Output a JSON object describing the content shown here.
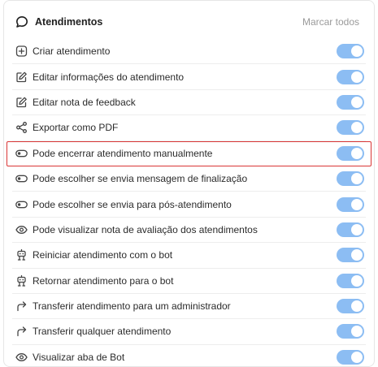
{
  "header": {
    "title": "Atendimentos",
    "mark_all": "Marcar todos",
    "icon": "chat-bubble-icon"
  },
  "colors": {
    "toggle_on": "#8cbdf3",
    "highlight_border": "#d93636"
  },
  "permissions": [
    {
      "label": "Criar atendimento",
      "icon": "plus-square-icon",
      "enabled": true
    },
    {
      "label": "Editar informações do atendimento",
      "icon": "edit-icon",
      "enabled": true
    },
    {
      "label": "Editar nota de feedback",
      "icon": "edit-icon",
      "enabled": true
    },
    {
      "label": "Exportar como PDF",
      "icon": "share-icon",
      "enabled": true
    },
    {
      "label": "Pode encerrar atendimento manualmente",
      "icon": "toggle-icon",
      "enabled": true,
      "highlighted": true
    },
    {
      "label": "Pode escolher se envia mensagem de finalização",
      "icon": "toggle-icon",
      "enabled": true
    },
    {
      "label": "Pode escolher se envia para pós-atendimento",
      "icon": "toggle-icon",
      "enabled": true
    },
    {
      "label": "Pode visualizar nota de avaliação dos atendimentos",
      "icon": "eye-icon",
      "enabled": true
    },
    {
      "label": "Reiniciar atendimento com o bot",
      "icon": "robot-icon",
      "enabled": true
    },
    {
      "label": "Retornar atendimento para o bot",
      "icon": "robot-icon",
      "enabled": true
    },
    {
      "label": "Transferir atendimento para um administrador",
      "icon": "forward-arrow-icon",
      "enabled": true
    },
    {
      "label": "Transferir qualquer atendimento",
      "icon": "forward-arrow-icon",
      "enabled": true
    },
    {
      "label": "Visualizar aba de Bot",
      "icon": "eye-icon",
      "enabled": true
    }
  ]
}
